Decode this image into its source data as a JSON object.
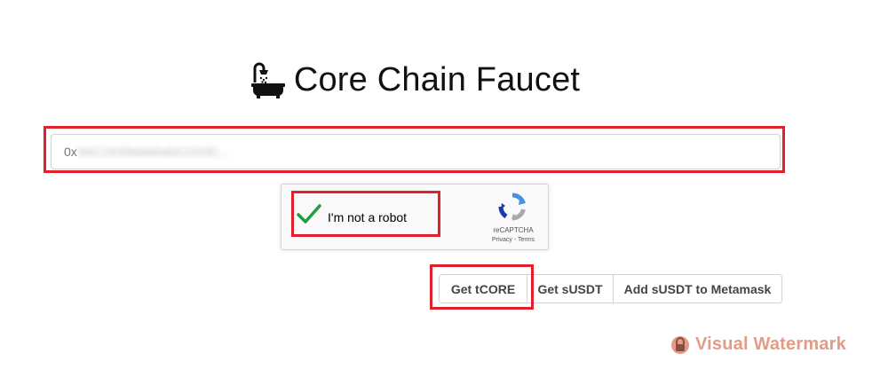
{
  "header": {
    "title": "Core Chain Faucet",
    "icon": "bathtub-icon"
  },
  "address_field": {
    "value_prefix": "0x",
    "value_redacted": "9AC1fc59d4d4a6A1533C...",
    "placeholder": ""
  },
  "recaptcha": {
    "checkbox_state": "checked",
    "label": "I'm not a robot",
    "brand": "reCAPTCHA",
    "links": "Privacy - Terms"
  },
  "actions": {
    "get_tcore_label": "Get tCORE",
    "get_susdt_label": "Get sUSDT",
    "add_susdt_label": "Add sUSDT to Metamask"
  },
  "watermark": {
    "text": "Visual Watermark"
  },
  "colors": {
    "highlight": "#e0202a",
    "check_green": "#1e9e45",
    "watermark": "#e0917a"
  }
}
